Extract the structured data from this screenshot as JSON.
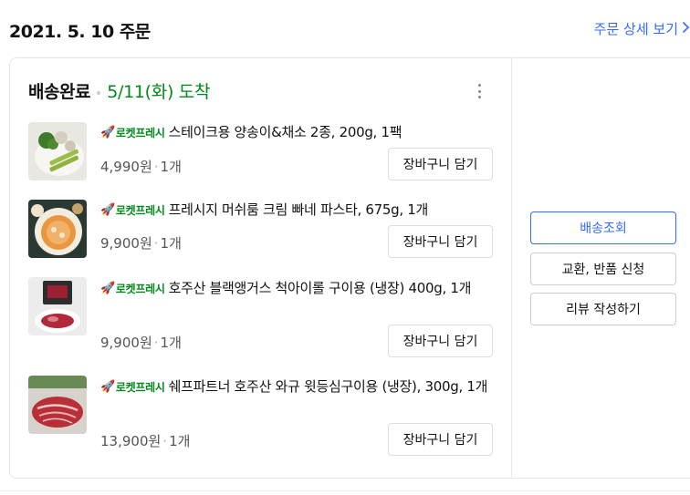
{
  "order": {
    "date_title": "2021. 5. 10 주문",
    "detail_link": "주문 상세 보기",
    "status": "배송완료",
    "arrival": "5/11(화) 도착"
  },
  "badge_label": "로켓프레시",
  "items": [
    {
      "name": "스테이크용 양송이&채소 2종, 200g, 1팩",
      "price": "4,990원",
      "qty": "1개",
      "cart_label": "장바구니 담기"
    },
    {
      "name": "프레시지 머쉬룸 크림 빠네 파스타, 675g, 1개",
      "price": "9,900원",
      "qty": "1개",
      "cart_label": "장바구니 담기"
    },
    {
      "name": "호주산 블랙앵거스 척아이롤 구이용 (냉장) 400g, 1개",
      "price": "9,900원",
      "qty": "1개",
      "cart_label": "장바구니 담기"
    },
    {
      "name": "쉐프파트너 호주산 와규 윗등심구이용 (냉장), 300g, 1개",
      "price": "13,900원",
      "qty": "1개",
      "cart_label": "장바구니 담기"
    }
  ],
  "actions": {
    "track": "배송조회",
    "exchange": "교환, 반품 신청",
    "review": "리뷰 작성하기"
  },
  "colors": {
    "accent_blue": "#346aff",
    "rocket_green": "#00891a"
  }
}
